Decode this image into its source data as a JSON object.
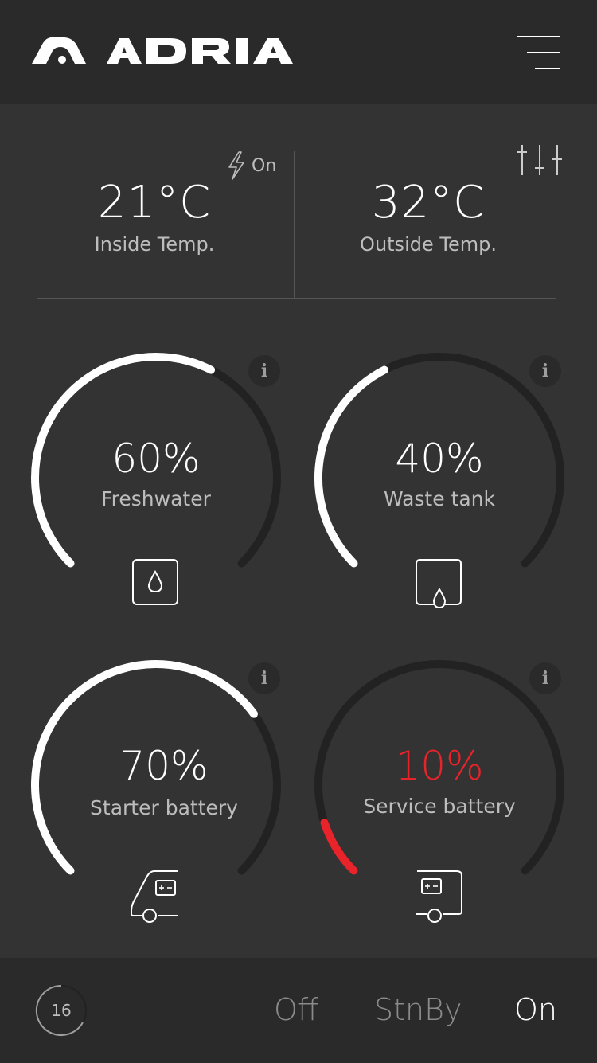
{
  "header": {
    "brand": "ADRIA",
    "menu_icon": "hamburger-menu-icon"
  },
  "climate": {
    "inside": {
      "value": "21°C",
      "label": "Inside Temp."
    },
    "outside": {
      "value": "32°C",
      "label": "Outside Temp."
    },
    "heater_status": "On",
    "heater_icon": "lightning-icon",
    "settings_icon": "sliders-icon"
  },
  "tanks": {
    "freshwater": {
      "value": "60%",
      "label": "Freshwater",
      "level": 0.6,
      "color": "#ffffff",
      "icon": "water-drop-icon"
    },
    "waste": {
      "value": "40%",
      "label": "Waste tank",
      "level": 0.4,
      "color": "#ffffff",
      "icon": "waste-tank-icon"
    },
    "starter": {
      "value": "70%",
      "label": "Starter battery",
      "level": 0.7,
      "color": "#ffffff",
      "icon": "car-battery-icon"
    },
    "service": {
      "value": "10%",
      "label": "Service battery",
      "level": 0.1,
      "color": "#e8232a",
      "icon": "caravan-battery-icon"
    }
  },
  "footer": {
    "timer": "16",
    "modes": [
      "Off",
      "StnBy",
      "On"
    ],
    "active_mode": "On"
  },
  "colors": {
    "background": "#333333",
    "bar": "#2a2a2a",
    "track": "#222222",
    "alert": "#e8232a"
  }
}
